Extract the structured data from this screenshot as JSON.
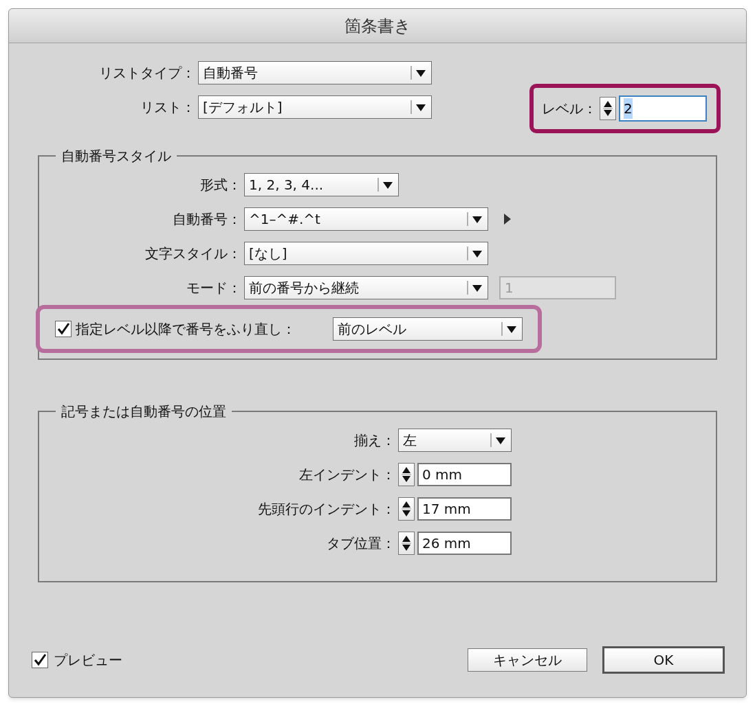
{
  "window": {
    "title": "箇条書き"
  },
  "list_settings": {
    "fields": [
      {
        "label": "リストタイプ：",
        "value": "自動番号"
      },
      {
        "label": "リスト：",
        "value": "[デフォルト]"
      }
    ],
    "level": {
      "label": "レベル：",
      "value": "2",
      "highlighted": true
    }
  },
  "numbering_style": {
    "title": "自動番号スタイル",
    "fields": [
      {
        "label": "形式：",
        "value": "1, 2, 3, 4...",
        "kind": "narrow",
        "flyout": false
      },
      {
        "label": "自動番号：",
        "value": "^1–^#.^t",
        "kind": "wide",
        "flyout": true
      },
      {
        "label": "文字スタイル：",
        "value": "[なし]",
        "kind": "wide",
        "flyout": false
      },
      {
        "label": "モード：",
        "value": "前の番号から継続",
        "kind": "wide",
        "flyout": false,
        "start_at": {
          "value": "1",
          "disabled": true
        }
      }
    ],
    "restart": {
      "label": "指定レベル以降で番号をふり直し：",
      "checked": true,
      "value": "前のレベル",
      "highlighted": true
    }
  },
  "position": {
    "title": "記号または自動番号の位置",
    "fields": [
      {
        "kind": "dropdown",
        "label": "揃え：",
        "value": "左"
      },
      {
        "kind": "spinner",
        "label": "左インデント：",
        "value": "0 mm"
      },
      {
        "kind": "spinner",
        "label": "先頭行のインデント：",
        "value": "17 mm"
      },
      {
        "kind": "spinner",
        "label": "タブ位置：",
        "value": "26 mm"
      }
    ]
  },
  "preview": {
    "label": "プレビュー",
    "checked": true
  },
  "buttons": [
    {
      "label": "キャンセル",
      "default": false
    },
    {
      "label": "OK",
      "default": true
    }
  ]
}
